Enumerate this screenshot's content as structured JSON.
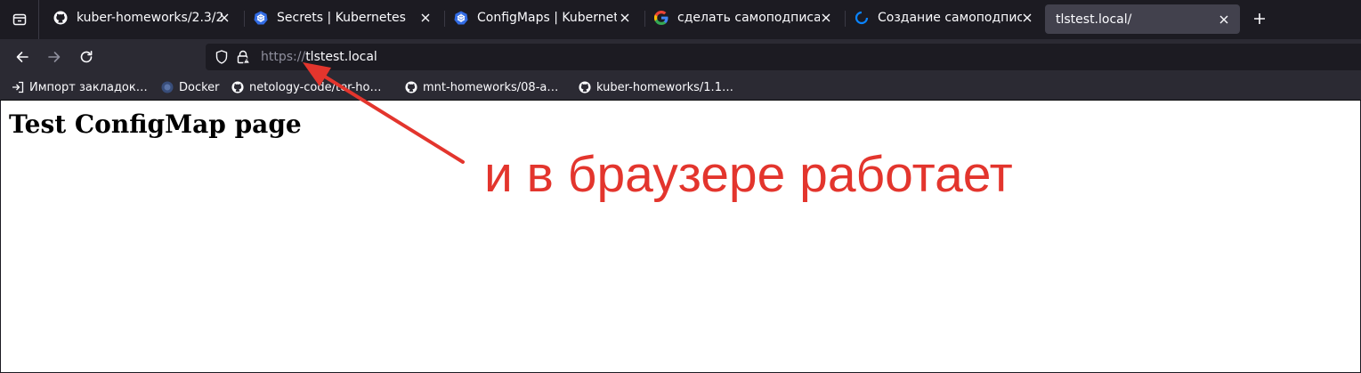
{
  "window": {
    "title": "tlstest.local/"
  },
  "tabs": [
    {
      "title": "kuber-homeworks/2.3/2.",
      "favicon": "github-icon",
      "active": false
    },
    {
      "title": "Secrets | Kubernetes",
      "favicon": "kubernetes-icon",
      "active": false
    },
    {
      "title": "ConfigMaps | Kubernete",
      "favicon": "kubernetes-icon",
      "active": false
    },
    {
      "title": "сделать самоподписанн",
      "favicon": "google-icon",
      "active": false
    },
    {
      "title": "Создание самоподписа",
      "favicon": "loading-icon",
      "active": false
    },
    {
      "title": "tlstest.local/",
      "favicon": "",
      "active": true
    }
  ],
  "navbar": {
    "back": "back-icon",
    "forward": "forward-icon",
    "reload": "reload-icon"
  },
  "urlbar": {
    "scheme": "https://",
    "host": "tlstest.local"
  },
  "bookmarks": [
    {
      "label": "Импорт закладок…",
      "icon": "import-icon"
    },
    {
      "label": "Docker",
      "icon": "docker-icon"
    },
    {
      "label": "netology-code/ter-ho…",
      "icon": "github-icon"
    },
    {
      "label": "mnt-homeworks/08-a…",
      "icon": "github-icon"
    },
    {
      "label": "kuber-homeworks/1.1…",
      "icon": "github-icon"
    }
  ],
  "page": {
    "heading": "Test ConfigMap page"
  },
  "annotation": {
    "text": "и в браузере работает",
    "color": "#e3352d"
  },
  "colors": {
    "tabstrip": "#1c1b22",
    "toolbar": "#2b2a33",
    "active_tab": "#42414d",
    "text": "#fbfbfe"
  }
}
